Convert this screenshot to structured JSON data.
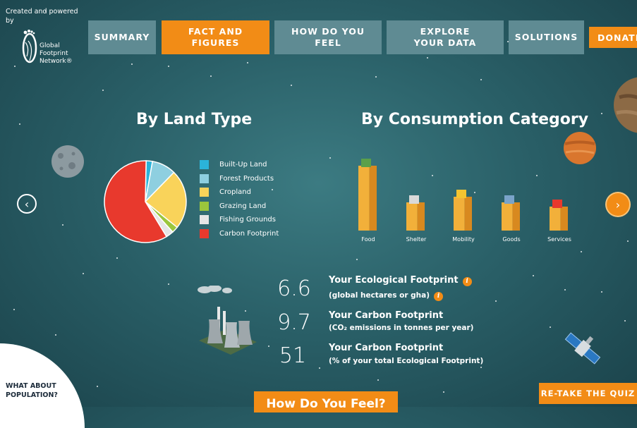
{
  "header": {
    "credit": "Created and powered by",
    "logo_text": [
      "Global",
      "Footprint",
      "Network®"
    ]
  },
  "nav": {
    "items": [
      {
        "label": "SUMMARY"
      },
      {
        "label": "FACT AND FIGURES",
        "active": true
      },
      {
        "label": "HOW DO YOU FEEL"
      },
      {
        "label": "EXPLORE YOUR DATA"
      },
      {
        "label": "SOLUTIONS"
      }
    ],
    "donate": "DONATE"
  },
  "land_type": {
    "heading": "By Land Type",
    "legend": [
      {
        "label": "Built-Up Land",
        "color": "#2bb3d9"
      },
      {
        "label": "Forest Products",
        "color": "#8ecfe0"
      },
      {
        "label": "Cropland",
        "color": "#f9d35a"
      },
      {
        "label": "Grazing Land",
        "color": "#9bc63c"
      },
      {
        "label": "Fishing Grounds",
        "color": "#e6e6e6"
      },
      {
        "label": "Carbon Footprint",
        "color": "#e8392d"
      }
    ]
  },
  "consumption": {
    "heading": "By Consumption Category",
    "categories": [
      "Food",
      "Shelter",
      "Mobility",
      "Goods",
      "Services"
    ]
  },
  "chart_data": [
    {
      "type": "pie",
      "title": "By Land Type",
      "categories": [
        "Built-Up Land",
        "Forest Products",
        "Cropland",
        "Grazing Land",
        "Fishing Grounds",
        "Carbon Footprint"
      ],
      "values": [
        2.5,
        9.5,
        23.5,
        2.5,
        3,
        59
      ],
      "colors": [
        "#2bb3d9",
        "#8ecfe0",
        "#f9d35a",
        "#9bc63c",
        "#e6e6e6",
        "#e8392d"
      ]
    },
    {
      "type": "bar",
      "title": "By Consumption Category",
      "categories": [
        "Food",
        "Shelter",
        "Mobility",
        "Goods",
        "Services"
      ],
      "values": [
        92,
        40,
        48,
        40,
        34
      ]
    }
  ],
  "stats": [
    {
      "value": "6.6",
      "title": "Your Ecological Footprint",
      "subtitle": "(global hectares or gha)",
      "info_icon": "info-icon"
    },
    {
      "value": "9.7",
      "title": "Your Carbon Footprint",
      "subtitle": "(CO₂ emissions in tonnes per year)"
    },
    {
      "value": "51",
      "title": "Your Carbon Footprint",
      "subtitle": "(% of your total Ecological Footprint)"
    }
  ],
  "buttons": {
    "retake": "RE-TAKE THE QUIZ",
    "feel": "How Do You Feel?",
    "population": "WHAT ABOUT POPULATION?"
  },
  "icons": {
    "prev": "chevron-left-icon",
    "next": "chevron-right-icon",
    "info": "info-icon"
  }
}
